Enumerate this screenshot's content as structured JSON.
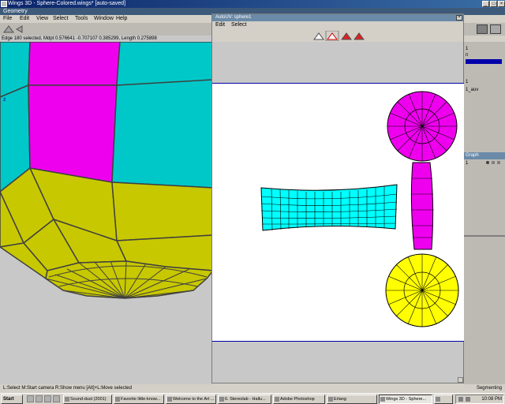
{
  "window": {
    "title": "Wings 3D - Sphere-Colored.wings* [auto-saved]",
    "geometry_label": "Geometry"
  },
  "menu": [
    "File",
    "Edit",
    "View",
    "Select",
    "Tools",
    "Window",
    "Help"
  ],
  "status_line": "Edge 180 selected, Mdpt 0.576641 -0.707107 0.385299, Length 0.275898",
  "viewport_label": "z",
  "right_panel": {
    "outliner_items": [
      "1",
      "n",
      "1",
      "1_auv"
    ],
    "graph_title": "Graph",
    "graph_item": "1"
  },
  "autouv": {
    "title": "AutoUV: sphere1",
    "menu": [
      "Edit",
      "Select"
    ],
    "tool_icons": [
      "vertex-mode-icon",
      "edge-mode-icon",
      "face-mode-icon",
      "body-mode-icon"
    ]
  },
  "bottom_status": {
    "hint": "L:Select  M:Start camera  R:Show menu  [Alt]+L:Move selected",
    "mode": "Segmenting"
  },
  "taskbar": {
    "start": "Start",
    "tasks": [
      "Sound-dust (2001)",
      "Favorite little-know...",
      "Welcome to the Art ...",
      "6. Stereolab - Hallu...",
      "Adobe Photoshop",
      "Erlang",
      "Wings 3D - Sphere...",
      ""
    ],
    "clock": "10:08 PM"
  },
  "colors": {
    "magenta": "#ee00ee",
    "cyan": "#00c8c8",
    "yellow": "#c8c800",
    "bright_yellow": "#ffff00",
    "title_blue": "#0a246a"
  }
}
